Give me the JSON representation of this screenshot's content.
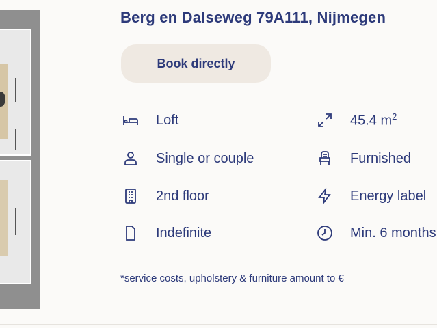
{
  "listing": {
    "address": "Berg en Dalseweg 79A111, Nijmegen",
    "book_button": "Book directly"
  },
  "features": {
    "type": {
      "icon": "bed-icon",
      "label": "Loft"
    },
    "occupancy": {
      "icon": "person-icon",
      "label": "Single or couple"
    },
    "floor": {
      "icon": "building-icon",
      "label": "2nd floor"
    },
    "duration": {
      "icon": "document-icon",
      "label": "Indefinite"
    },
    "area": {
      "icon": "expand-arrows-icon",
      "value": "45.4 m",
      "superscript": "2"
    },
    "furnishing": {
      "icon": "chair-icon",
      "label": "Furnished"
    },
    "energy": {
      "icon": "lightning-icon",
      "label": "Energy label"
    },
    "min_rental": {
      "icon": "clock-icon",
      "label": "Min. 6 months"
    }
  },
  "footnote": "*service costs, upholstery & furniture amount to €",
  "colors": {
    "primary_text": "#2d3a7a",
    "button_bg": "#efe9e2",
    "page_bg": "#fbfaf8"
  }
}
